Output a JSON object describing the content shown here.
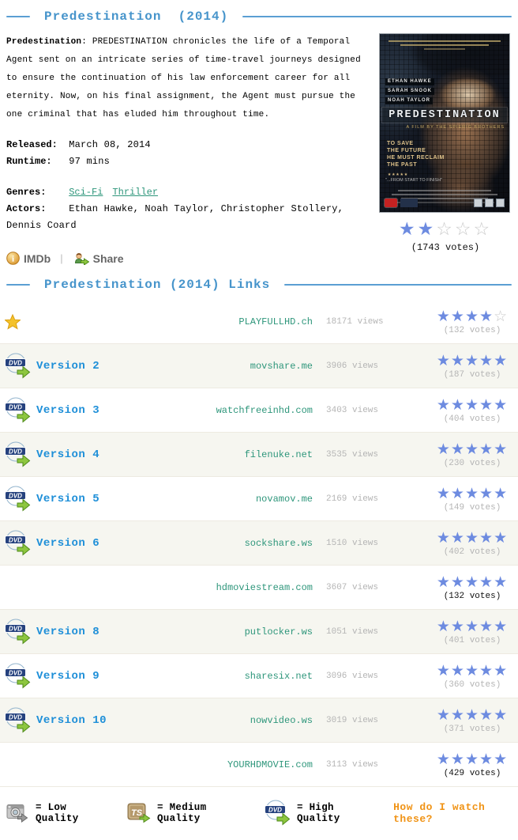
{
  "header": {
    "title": "Predestination  (2014)"
  },
  "movie": {
    "description_lead": "Predestination",
    "description_rest": ": PREDESTINATION chronicles the life of a Temporal Agent sent on an intricate series of time-travel journeys designed to ensure the continuation of his law enforcement career for all eternity. Now, on his final assignment, the Agent must pursue the one criminal that has eluded him throughout time.",
    "released_label": "Released:",
    "released": "March 08, 2014",
    "runtime_label": "Runtime:",
    "runtime": "97 mins",
    "genres_label": "Genres:",
    "genres": [
      "Sci-Fi",
      "Thriller"
    ],
    "actors_label": "Actors:",
    "actors": "Ethan Hawke, Noah Taylor, Christopher Stollery, Dennis Coard",
    "imdb_label": "IMDb",
    "share_label": "Share",
    "rating": {
      "stars": 2,
      "max": 5,
      "votes": "(1743 votes)"
    },
    "poster": {
      "cast": [
        "ETHAN HAWKE",
        "SARAH SNOOK",
        "NOAH TAYLOR"
      ],
      "title": "PREDESTINATION",
      "credit": "A FILM BY THE SPIERIG BROTHERS",
      "tagline": [
        "TO SAVE",
        "THE FUTURE",
        "HE MUST RECLAIM",
        "THE PAST"
      ],
      "review_stars": "★★★★★",
      "review_quote": "\"...FROM START TO FINISH\""
    }
  },
  "links": {
    "title": "Predestination (2014) Links",
    "rows": [
      {
        "icon": "star",
        "label": "",
        "site": "PLAYFULLHD.ch",
        "views": "18171 views",
        "stars": 4,
        "votes": "(132 votes)",
        "votes_dark": false
      },
      {
        "icon": "dvd",
        "label": "Version 2",
        "site": "movshare.me",
        "views": "3906 views",
        "stars": 5,
        "votes": "(187 votes)",
        "votes_dark": false
      },
      {
        "icon": "dvd",
        "label": "Version 3",
        "site": "watchfreeinhd.com",
        "views": "3403 views",
        "stars": 5,
        "votes": "(404 votes)",
        "votes_dark": false
      },
      {
        "icon": "dvd",
        "label": "Version 4",
        "site": "filenuke.net",
        "views": "3535 views",
        "stars": 5,
        "votes": "(230 votes)",
        "votes_dark": false
      },
      {
        "icon": "dvd",
        "label": "Version 5",
        "site": "novamov.me",
        "views": "2169 views",
        "stars": 5,
        "votes": "(149 votes)",
        "votes_dark": false
      },
      {
        "icon": "dvd",
        "label": "Version 6",
        "site": "sockshare.ws",
        "views": "1510 views",
        "stars": 5,
        "votes": "(402 votes)",
        "votes_dark": false
      },
      {
        "icon": "none",
        "label": "",
        "site": "hdmoviestream.com",
        "views": "3607 views",
        "stars": 5,
        "votes": "(132 votes)",
        "votes_dark": true
      },
      {
        "icon": "dvd",
        "label": "Version 8",
        "site": "putlocker.ws",
        "views": "1051 views",
        "stars": 5,
        "votes": "(401 votes)",
        "votes_dark": false
      },
      {
        "icon": "dvd",
        "label": "Version 9",
        "site": "sharesix.net",
        "views": "3096 views",
        "stars": 5,
        "votes": "(360 votes)",
        "votes_dark": false
      },
      {
        "icon": "dvd",
        "label": "Version 10",
        "site": "nowvideo.ws",
        "views": "3019 views",
        "stars": 5,
        "votes": "(371 votes)",
        "votes_dark": false
      },
      {
        "icon": "none",
        "label": "",
        "site": "YOURHDMOVIE.com",
        "views": "3113 views",
        "stars": 5,
        "votes": "(429 votes)",
        "votes_dark": true
      }
    ]
  },
  "legend": {
    "items": [
      {
        "icon": "camera",
        "text": "= Low Quality"
      },
      {
        "icon": "ts",
        "text": "= Medium Quality"
      },
      {
        "icon": "dvd",
        "text": "= High Quality"
      }
    ],
    "help": "How do I watch these?"
  }
}
